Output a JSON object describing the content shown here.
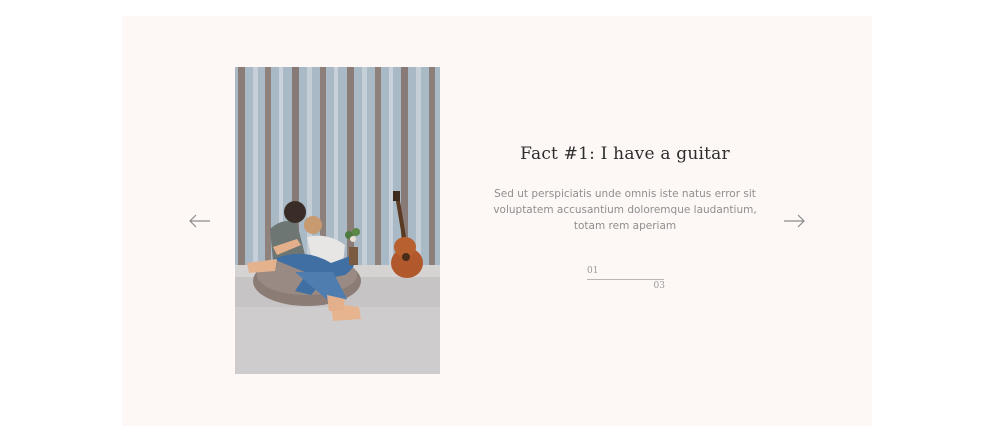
{
  "slider": {
    "prev_icon": "arrow-left-icon",
    "next_icon": "arrow-right-icon",
    "photo_alt": "Couple sitting on a bean bag next to a guitar",
    "title": "Fact #1: I have a guitar",
    "body": "Sed ut perspiciatis unde omnis iste natus error sit voluptatem accusantium doloremque laudantium, totam rem aperiam",
    "counter": {
      "current": "01",
      "total": "03"
    }
  },
  "colors": {
    "panel_background": "#fdf8f5",
    "title_text": "#2d2d2d",
    "body_text": "#8f8f8f",
    "arrow": "#8a8a8a"
  }
}
